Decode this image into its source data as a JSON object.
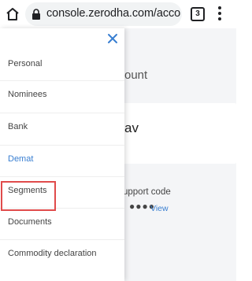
{
  "browser": {
    "url": "console.zerodha.com/account/",
    "tab_count": "3",
    "icons": [
      "home-icon",
      "lock-icon",
      "tabs-icon",
      "menu-icon"
    ]
  },
  "background": {
    "heading": "ount",
    "card_text": "av",
    "support_label": "upport code",
    "masked_value": "●●●●",
    "view_link": "View"
  },
  "drawer": {
    "close_icon": "close-icon",
    "items": [
      {
        "label": "Personal"
      },
      {
        "label": "Nominees"
      },
      {
        "label": "Bank"
      },
      {
        "label": "Demat",
        "active": true
      },
      {
        "label": "Segments",
        "highlighted": true
      },
      {
        "label": "Documents"
      },
      {
        "label": "Commodity declaration"
      }
    ]
  },
  "colors": {
    "accent": "#387ed1",
    "highlight": "#e04b4b"
  }
}
